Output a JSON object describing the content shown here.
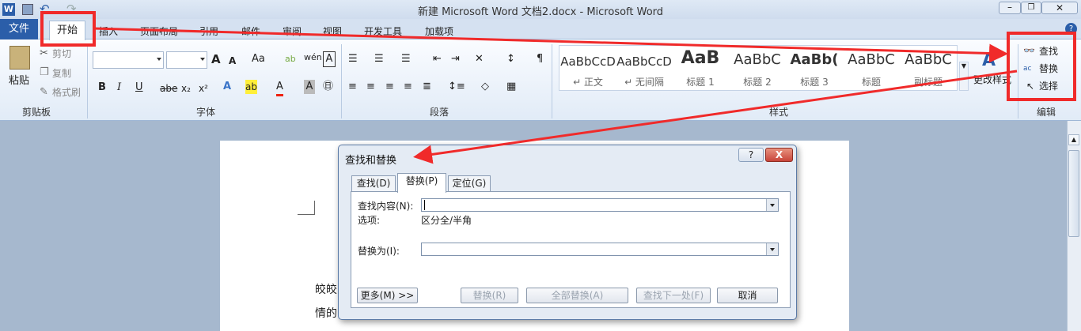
{
  "window": {
    "title": "新建 Microsoft Word 文档2.docx - Microsoft Word",
    "app_icon": "W"
  },
  "tabs": [
    "文件",
    "开始",
    "插入",
    "页面布局",
    "引用",
    "邮件",
    "审阅",
    "视图",
    "开发工具",
    "加载项"
  ],
  "clipboard": {
    "paste": "粘贴",
    "cut": "剪切",
    "copy": "复制",
    "format_painter": "格式刷",
    "label": "剪贴板"
  },
  "font": {
    "label": "字体",
    "bold": "B",
    "italic": "I",
    "underline": "U",
    "strike": "abe",
    "sub": "x₂",
    "sup": "x²",
    "grow": "A",
    "shrink": "A"
  },
  "paragraph": {
    "label": "段落"
  },
  "styles": {
    "label": "样式",
    "items": [
      {
        "preview": "AaBbCcD",
        "name": "↵ 正文"
      },
      {
        "preview": "AaBbCcD",
        "name": "↵ 无间隔"
      },
      {
        "preview": "AaB",
        "name": "标题 1"
      },
      {
        "preview": "AaBbC",
        "name": "标题 2"
      },
      {
        "preview": "AaBb(",
        "name": "标题 3"
      },
      {
        "preview": "AaBbC",
        "name": "标题"
      },
      {
        "preview": "AaBbC",
        "name": "副标题"
      }
    ],
    "change_styles": "更改样式"
  },
  "editing": {
    "label": "编辑",
    "find": "查找",
    "replace": "替换",
    "select": "选择"
  },
  "document": {
    "line1": "皎皎",
    "line2": "情的"
  },
  "dialog": {
    "title": "查找和替换",
    "help": "?",
    "close": "X",
    "tabs": [
      "查找(D)",
      "替换(P)",
      "定位(G)"
    ],
    "find_label": "查找内容(N):",
    "find_value": "",
    "options_label": "选项:",
    "options_value": "区分全/半角",
    "replace_label": "替换为(I):",
    "replace_value": "",
    "buttons": {
      "more": "更多(M) >>",
      "replace": "替换(R)",
      "replace_all": "全部替换(A)",
      "find_next": "查找下一处(F)",
      "cancel": "取消"
    }
  },
  "colors": {
    "accent": "#2b5ea9",
    "annotation": "#f02a2a"
  }
}
